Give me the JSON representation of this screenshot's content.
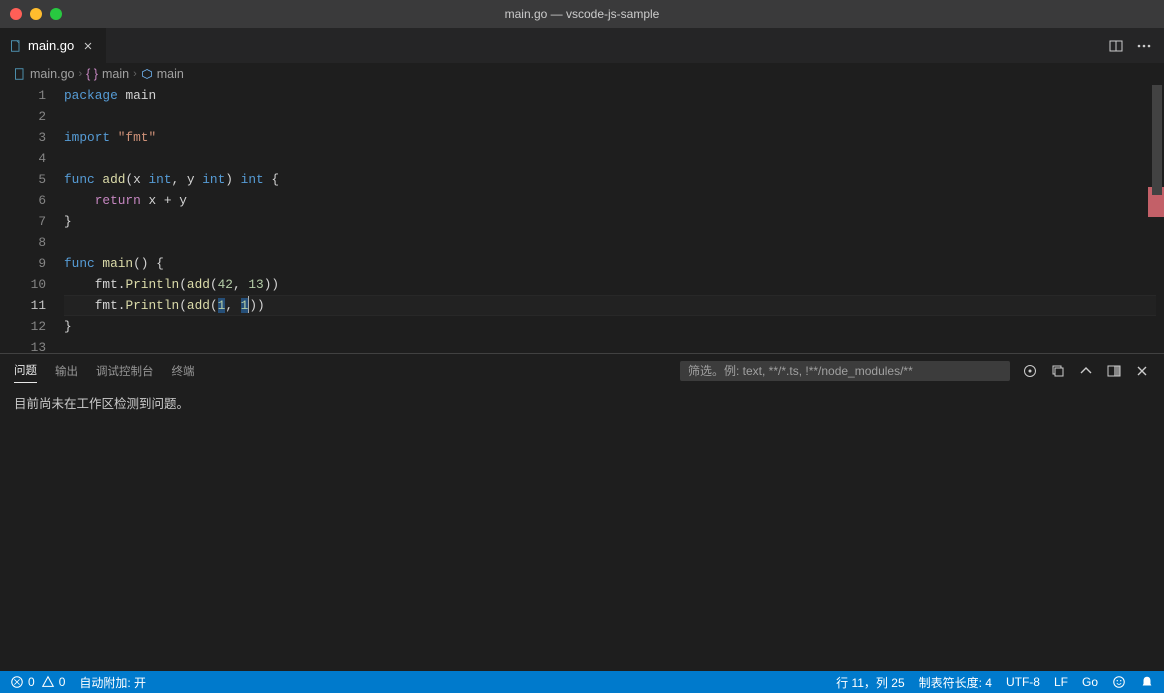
{
  "window": {
    "title": "main.go — vscode-js-sample"
  },
  "tab": {
    "filename": "main.go"
  },
  "breadcrumb": {
    "file": "main.go",
    "symbol1": "main",
    "symbol2": "main"
  },
  "editor": {
    "lines": [
      {
        "num": 1
      },
      {
        "num": 2
      },
      {
        "num": 3
      },
      {
        "num": 4
      },
      {
        "num": 5
      },
      {
        "num": 6
      },
      {
        "num": 7
      },
      {
        "num": 8
      },
      {
        "num": 9
      },
      {
        "num": 10
      },
      {
        "num": 11
      },
      {
        "num": 12
      },
      {
        "num": 13
      }
    ],
    "tokens": {
      "l1_package": "package",
      "l1_main": " main",
      "l3_import": "import",
      "l3_fmt": " \"fmt\"",
      "l5_func": "func",
      "l5_add": " add",
      "l5_sig1": "(x ",
      "l5_int1": "int",
      "l5_sig2": ", y ",
      "l5_int2": "int",
      "l5_sig3": ") ",
      "l5_int3": "int",
      "l5_sig4": " {",
      "l6_indent": "    ",
      "l6_return": "return",
      "l6_expr": " x + y",
      "l7_brace": "}",
      "l9_func": "func",
      "l9_main": " main",
      "l9_rest": "() {",
      "l10_indent": "    fmt.",
      "l10_println": "Println",
      "l10_open": "(",
      "l10_add": "add",
      "l10_p1": "(",
      "l10_n1": "42",
      "l10_c": ", ",
      "l10_n2": "13",
      "l10_close": "))",
      "l11_indent": "    fmt.",
      "l11_println": "Println",
      "l11_open": "(",
      "l11_add": "add",
      "l11_p1": "(",
      "l11_n1": "1",
      "l11_c": ", ",
      "l11_n2": "1",
      "l11_close": "))",
      "l12_brace": "}"
    }
  },
  "panel": {
    "tabs": {
      "problems": "问题",
      "output": "输出",
      "debug": "调试控制台",
      "terminal": "终端"
    },
    "filter_placeholder": "筛选。例: text, **/*.ts, !**/node_modules/**",
    "body": "目前尚未在工作区检测到问题。"
  },
  "statusbar": {
    "errors_count": "0",
    "warnings_count": "0",
    "auto_attach": "自动附加: 开",
    "line_col": "行 11，列 25",
    "tab_size": "制表符长度: 4",
    "encoding": "UTF-8",
    "eol": "LF",
    "language": "Go"
  }
}
